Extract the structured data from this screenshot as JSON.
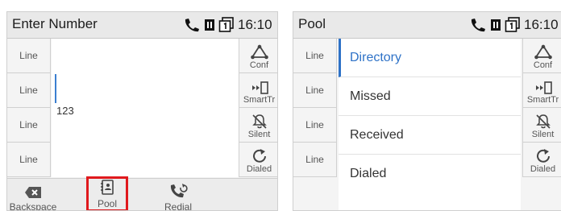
{
  "screen1": {
    "title": "Enter Number",
    "clock": "16:10",
    "line_keys": [
      "Line",
      "Line",
      "Line",
      "Line"
    ],
    "soft_keys": [
      {
        "label": "Conf",
        "icon": "conference-icon"
      },
      {
        "label": "SmartTr",
        "icon": "smart-transfer-icon"
      },
      {
        "label": "Silent",
        "icon": "bell-off-icon"
      },
      {
        "label": "Dialed",
        "icon": "redial-arrow-icon"
      }
    ],
    "entered_number": "123",
    "bottom_keys": [
      {
        "label": "Backspace",
        "icon": "backspace-icon"
      },
      {
        "label": "Pool",
        "icon": "contacts-book-icon"
      },
      {
        "label": "Redial",
        "icon": "redial-phone-icon"
      }
    ]
  },
  "screen2": {
    "title": "Pool",
    "clock": "16:10",
    "line_keys": [
      "Line",
      "Line",
      "Line",
      "Line"
    ],
    "menu_items": [
      "Directory",
      "Missed",
      "Received",
      "Dialed"
    ],
    "selected_index": 0,
    "soft_keys": [
      {
        "label": "Conf",
        "icon": "conference-icon"
      },
      {
        "label": "SmartTr",
        "icon": "smart-transfer-icon"
      },
      {
        "label": "Silent",
        "icon": "bell-off-icon"
      },
      {
        "label": "Dialed",
        "icon": "redial-arrow-icon"
      }
    ]
  },
  "colors": {
    "accent": "#2e72c7",
    "highlight": "#e0191d"
  }
}
